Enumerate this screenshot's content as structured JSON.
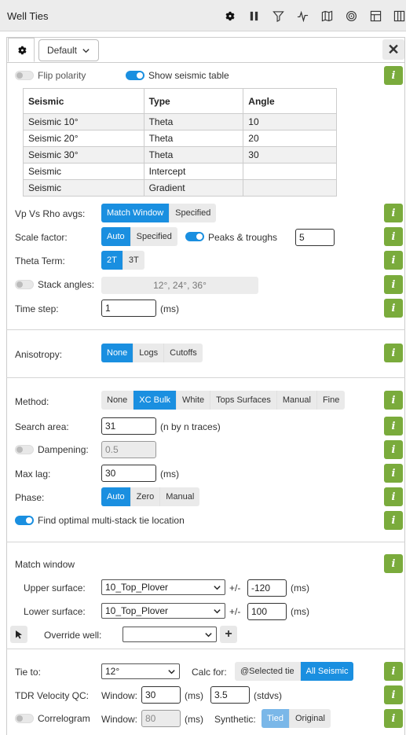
{
  "app": {
    "title": "Well Ties"
  },
  "toolbar": {
    "icons": [
      "gear-icon",
      "pause-icon",
      "filter-icon",
      "waveform-icon",
      "map-icon",
      "target-icon",
      "grid-icon",
      "columns-icon"
    ]
  },
  "tabs": {
    "preset": "Default"
  },
  "seismic": {
    "flip_polarity_label": "Flip polarity",
    "flip_polarity": false,
    "show_table_label": "Show seismic table",
    "show_table": true,
    "headers": [
      "Seismic",
      "Type",
      "Angle"
    ],
    "rows": [
      [
        "Seismic 10°",
        "Theta",
        "10"
      ],
      [
        "Seismic 20°",
        "Theta",
        "20"
      ],
      [
        "Seismic 30°",
        "Theta",
        "30"
      ],
      [
        "Seismic",
        "Intercept",
        ""
      ],
      [
        "Seismic",
        "Gradient",
        ""
      ]
    ]
  },
  "avgs": {
    "label": "Vp Vs Rho avgs:",
    "options": [
      "Match Window",
      "Specified"
    ],
    "selected": "Match Window"
  },
  "scale": {
    "label": "Scale factor:",
    "options": [
      "Auto",
      "Specified"
    ],
    "selected": "Auto",
    "peaks_label": "Peaks & troughs",
    "peaks_on": true,
    "peaks_value": "5"
  },
  "theta": {
    "label": "Theta Term:",
    "options": [
      "2T",
      "3T"
    ],
    "selected": "2T"
  },
  "stack": {
    "label": "Stack angles:",
    "on": false,
    "value": "12°, 24°, 36°"
  },
  "timestep": {
    "label": "Time step:",
    "value": "1",
    "unit": "(ms)"
  },
  "anisotropy": {
    "label": "Anisotropy:",
    "options": [
      "None",
      "Logs",
      "Cutoffs"
    ],
    "selected": "None"
  },
  "method": {
    "label": "Method:",
    "options": [
      "None",
      "XC Bulk",
      "White",
      "Tops Surfaces",
      "Manual",
      "Fine"
    ],
    "selected": "XC Bulk"
  },
  "search": {
    "label": "Search area:",
    "value": "31",
    "unit": "(n by n traces)"
  },
  "dampening": {
    "label": "Dampening:",
    "on": false,
    "value": "0.5"
  },
  "maxlag": {
    "label": "Max lag:",
    "value": "30",
    "unit": "(ms)"
  },
  "phase": {
    "label": "Phase:",
    "options": [
      "Auto",
      "Zero",
      "Manual"
    ],
    "selected": "Auto"
  },
  "optimal": {
    "label": "Find optimal multi-stack tie location",
    "on": true
  },
  "match": {
    "label": "Match window",
    "upper_label": "Upper surface:",
    "upper_value": "10_Top_Plover",
    "upper_pm": "+/-",
    "upper_offset": "-120",
    "lower_label": "Lower surface:",
    "lower_value": "10_Top_Plover",
    "lower_pm": "+/-",
    "lower_offset": "100",
    "unit": "(ms)",
    "override_label": "Override well:",
    "override_value": ""
  },
  "tie": {
    "label": "Tie to:",
    "value": "12°",
    "calc_label": "Calc for:",
    "calc_options": [
      "@Selected tie",
      "All Seismic"
    ],
    "calc_selected": "All Seismic"
  },
  "tdr": {
    "label": "TDR Velocity QC:",
    "window_label": "Window:",
    "window_value": "30",
    "unit": "(ms)",
    "stdvs_value": "3.5",
    "stdvs_unit": "(stdvs)"
  },
  "correlogram": {
    "label": "Correlogram",
    "on": false,
    "window_label": "Window:",
    "window_value": "80",
    "unit": "(ms)",
    "synthetic_label": "Synthetic:",
    "options": [
      "Tied",
      "Original"
    ],
    "selected": "Tied"
  },
  "info_label": "i",
  "colors": {
    "accent": "#1a8fe0",
    "info": "#7aab3c"
  }
}
